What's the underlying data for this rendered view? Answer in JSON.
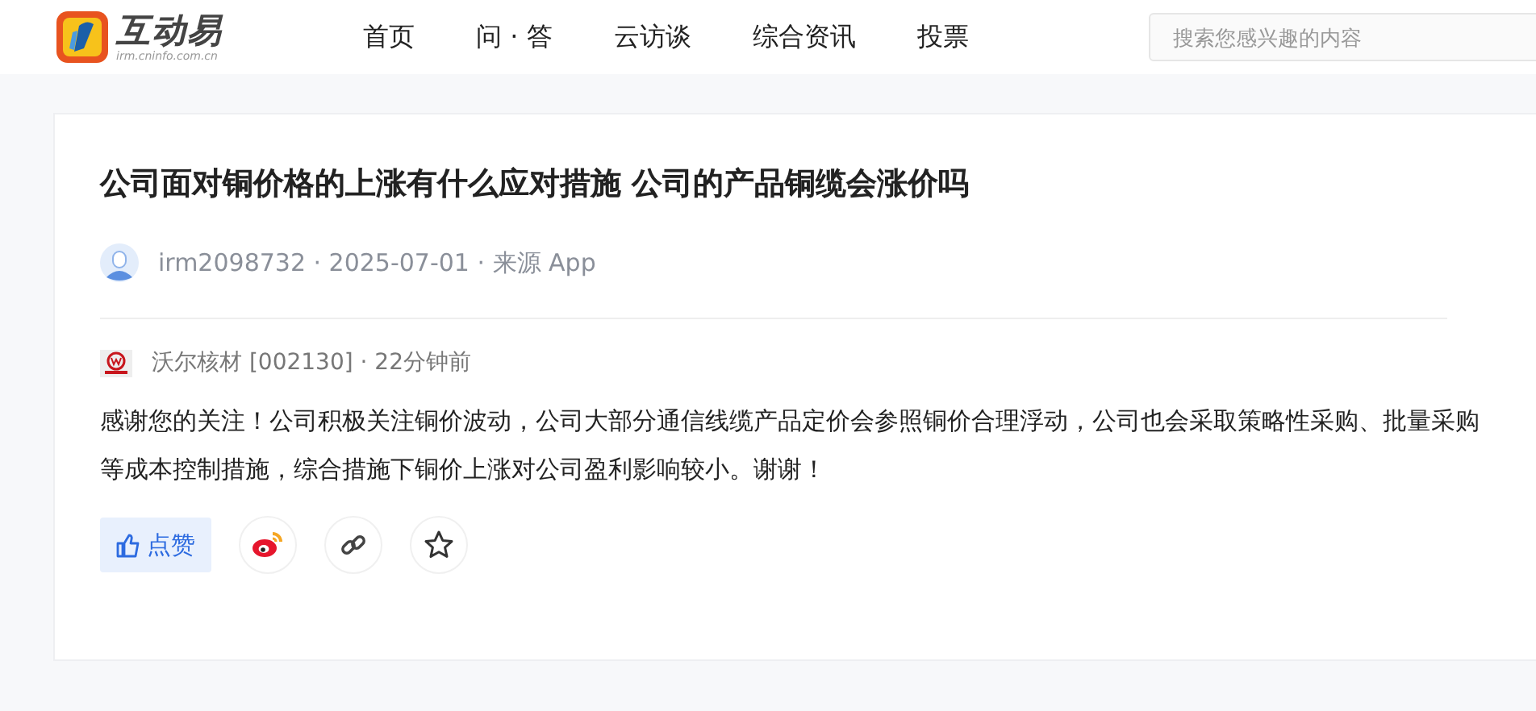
{
  "header": {
    "logo": {
      "name": "互动易",
      "domain": "irm.cninfo.com.cn"
    },
    "nav": [
      {
        "label": "首页"
      },
      {
        "label": "问 · 答"
      },
      {
        "label": "云访谈"
      },
      {
        "label": "综合资讯"
      },
      {
        "label": "投票"
      }
    ],
    "search": {
      "placeholder": "搜索您感兴趣的内容"
    }
  },
  "question": {
    "title": "公司面对铜价格的上涨有什么应对措施 公司的产品铜缆会涨价吗",
    "meta": "irm2098732 · 2025-07-01 · 来源 App"
  },
  "answer": {
    "company": "沃尔核材 [002130] · 22分钟前",
    "text": "感谢您的关注！公司积极关注铜价波动，公司大部分通信线缆产品定价会参照铜价合理浮动，公司也会采取策略性采购、批量采购等成本控制措施，综合措施下铜价上涨对公司盈利影响较小。谢谢！"
  },
  "actions": [
    {
      "kind": "like",
      "label": "点赞"
    },
    {
      "kind": "weibo"
    },
    {
      "kind": "link"
    },
    {
      "kind": "star"
    }
  ]
}
